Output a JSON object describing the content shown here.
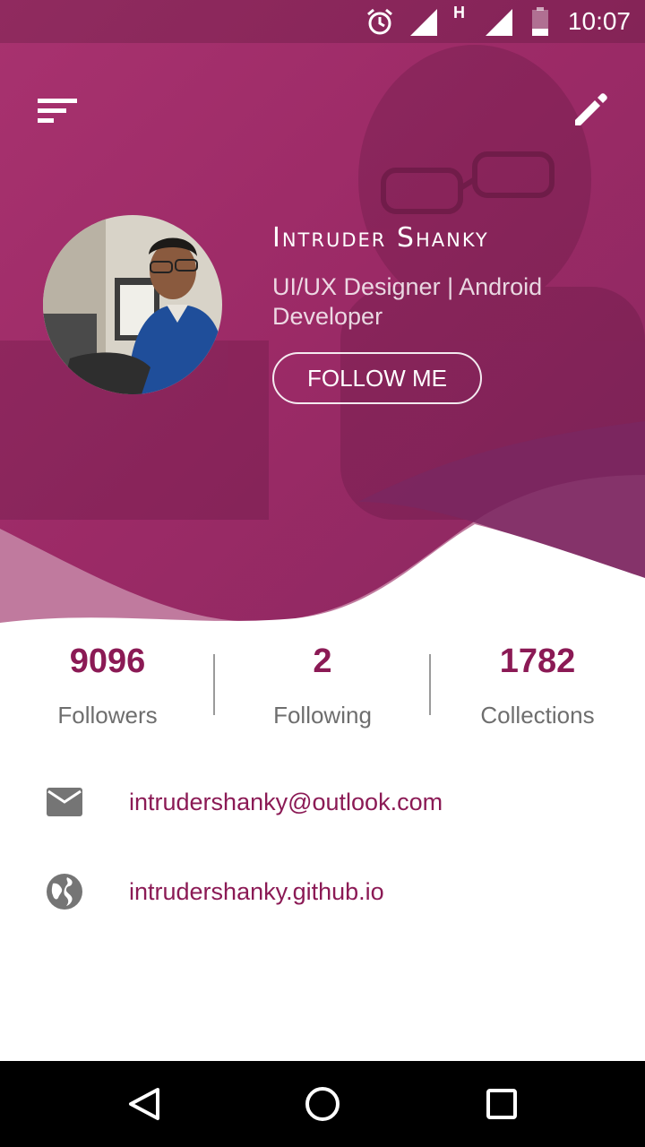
{
  "status_bar": {
    "time": "10:07",
    "network_label": "H",
    "icons": [
      "alarm-icon",
      "signal-icon",
      "signal-h-icon",
      "battery-icon"
    ]
  },
  "toolbar": {
    "menu_icon": "sort-menu-icon",
    "edit_icon": "pencil-edit-icon"
  },
  "profile": {
    "name": "Intruder Shanky",
    "title": "UI/UX Designer | Android Developer",
    "follow_label": "FOLLOW ME",
    "avatar": "profile-photo"
  },
  "stats": [
    {
      "value": "9096",
      "label": "Followers"
    },
    {
      "value": "2",
      "label": "Following"
    },
    {
      "value": "1782",
      "label": "Collections"
    }
  ],
  "contacts": [
    {
      "icon": "email-icon",
      "text": "intrudershanky@outlook.com"
    },
    {
      "icon": "globe-icon",
      "text": "intrudershanky.github.io"
    }
  ],
  "nav_bar": {
    "icons": [
      "back-icon",
      "home-icon",
      "recents-icon"
    ]
  },
  "colors": {
    "accent": "#8b1a55",
    "header_primary": "#a3346e",
    "wave_light": "#c07a9e",
    "wave_dark": "#7a2760",
    "label_gray": "#6e6e6e",
    "icon_gray": "#757575"
  }
}
